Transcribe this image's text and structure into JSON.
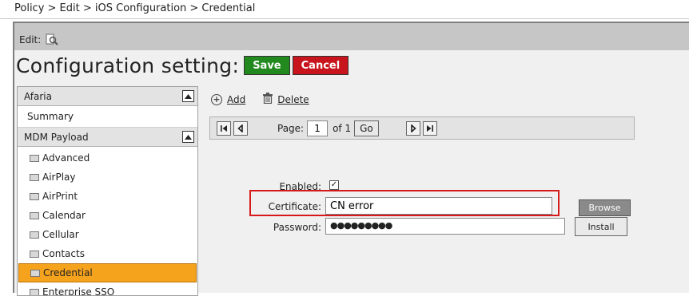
{
  "breadcrumb": "Policy > Edit > iOS Configuration > Credential",
  "editbar": {
    "label": "Edit:",
    "icon": "magnifier-edit-icon"
  },
  "header": {
    "title": "Configuration setting:",
    "save_label": "Save",
    "cancel_label": "Cancel"
  },
  "sidebar": {
    "group1": {
      "label": "Afaria",
      "collapse": "▲"
    },
    "summary": "Summary",
    "group2": {
      "label": "MDM Payload",
      "collapse": "▲"
    },
    "items": [
      {
        "label": "Advanced",
        "active": false
      },
      {
        "label": "AirPlay",
        "active": false
      },
      {
        "label": "AirPrint",
        "active": false
      },
      {
        "label": "Calendar",
        "active": false
      },
      {
        "label": "Cellular",
        "active": false
      },
      {
        "label": "Contacts",
        "active": false
      },
      {
        "label": "Credential",
        "active": true
      },
      {
        "label": "Enterprise SSO",
        "active": false
      }
    ]
  },
  "toolbar": {
    "add_label": "Add",
    "delete_label": "Delete"
  },
  "pager": {
    "page_label": "Page:",
    "page_value": "1",
    "of_label": "of 1",
    "go_label": "Go"
  },
  "form": {
    "enabled_label": "Enabled:",
    "enabled_checked": true,
    "certificate_label": "Certificate:",
    "certificate_value": "CN error",
    "password_label": "Password:",
    "password_value": "●●●●●●●●●",
    "browse_label": "Browse",
    "install_label": "Install"
  },
  "colors": {
    "save": "#22891f",
    "cancel": "#c8141c",
    "active_item": "#f5a21c",
    "highlight": "#d61a1a"
  }
}
